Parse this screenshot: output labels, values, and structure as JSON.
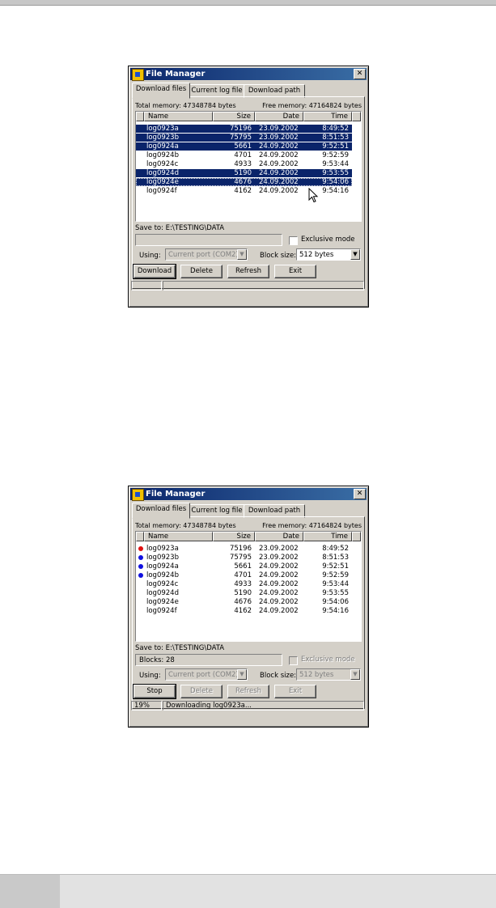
{
  "windows": [
    {
      "title": "File Manager",
      "close_glyph": "✕",
      "tabs": [
        "Download files",
        "Current log file",
        "Download path"
      ],
      "total_memory": "Total memory: 47348784 bytes",
      "free_memory": "Free memory: 47164824 bytes",
      "columns": [
        "Name",
        "Size",
        "Date",
        "Time"
      ],
      "rows": [
        {
          "name": "log0923a",
          "size": "75196",
          "date": "23.09.2002",
          "time": "8:49:52",
          "selected": true
        },
        {
          "name": "log0923b",
          "size": "75795",
          "date": "23.09.2002",
          "time": "8:51:53",
          "selected": true
        },
        {
          "name": "log0924a",
          "size": "5661",
          "date": "24.09.2002",
          "time": "9:52:51",
          "selected": true
        },
        {
          "name": "log0924b",
          "size": "4701",
          "date": "24.09.2002",
          "time": "9:52:59",
          "selected": false
        },
        {
          "name": "log0924c",
          "size": "4933",
          "date": "24.09.2002",
          "time": "9:53:44",
          "selected": false
        },
        {
          "name": "log0924d",
          "size": "5190",
          "date": "24.09.2002",
          "time": "9:53:55",
          "selected": true
        },
        {
          "name": "log0924e",
          "size": "4676",
          "date": "24.09.2002",
          "time": "9:54:06",
          "selected": true,
          "focused": true
        },
        {
          "name": "log0924f",
          "size": "4162",
          "date": "24.09.2002",
          "time": "9:54:16",
          "selected": false
        }
      ],
      "save_to": "Save to: E:\\TESTING\\DATA",
      "info_box": "",
      "exclusive_label": "Exclusive mode",
      "using_label": "Using:",
      "using_value": "Current port (COM2)",
      "block_label": "Block size:",
      "block_value": "512 bytes",
      "buttons": [
        "Download",
        "Delete",
        "Refresh",
        "Exit"
      ],
      "status_left": "",
      "status_right": ""
    },
    {
      "title": "File Manager",
      "close_glyph": "✕",
      "tabs": [
        "Download files",
        "Current log file",
        "Download path"
      ],
      "total_memory": "Total memory: 47348784 bytes",
      "free_memory": "Free memory: 47164824 bytes",
      "columns": [
        "Name",
        "Size",
        "Date",
        "Time"
      ],
      "rows": [
        {
          "name": "log0923a",
          "size": "75196",
          "date": "23.09.2002",
          "time": "8:49:52",
          "dot": "#e01010"
        },
        {
          "name": "log0923b",
          "size": "75795",
          "date": "23.09.2002",
          "time": "8:51:53",
          "dot": "#1010e0"
        },
        {
          "name": "log0924a",
          "size": "5661",
          "date": "24.09.2002",
          "time": "9:52:51",
          "dot": "#1010e0"
        },
        {
          "name": "log0924b",
          "size": "4701",
          "date": "24.09.2002",
          "time": "9:52:59",
          "dot": "#1010e0"
        },
        {
          "name": "log0924c",
          "size": "4933",
          "date": "24.09.2002",
          "time": "9:53:44"
        },
        {
          "name": "log0924d",
          "size": "5190",
          "date": "24.09.2002",
          "time": "9:53:55"
        },
        {
          "name": "log0924e",
          "size": "4676",
          "date": "24.09.2002",
          "time": "9:54:06"
        },
        {
          "name": "log0924f",
          "size": "4162",
          "date": "24.09.2002",
          "time": "9:54:16"
        }
      ],
      "save_to": "Save to: E:\\TESTING\\DATA",
      "info_box": "Blocks: 28",
      "exclusive_label": "Exclusive mode",
      "using_label": "Using:",
      "using_value": "Current port (COM2)",
      "block_label": "Block size:",
      "block_value": "512 bytes",
      "buttons": [
        "Stop",
        "Delete",
        "Refresh",
        "Exit"
      ],
      "status_left": "19%",
      "status_right": "Downloading log0923a..."
    }
  ]
}
